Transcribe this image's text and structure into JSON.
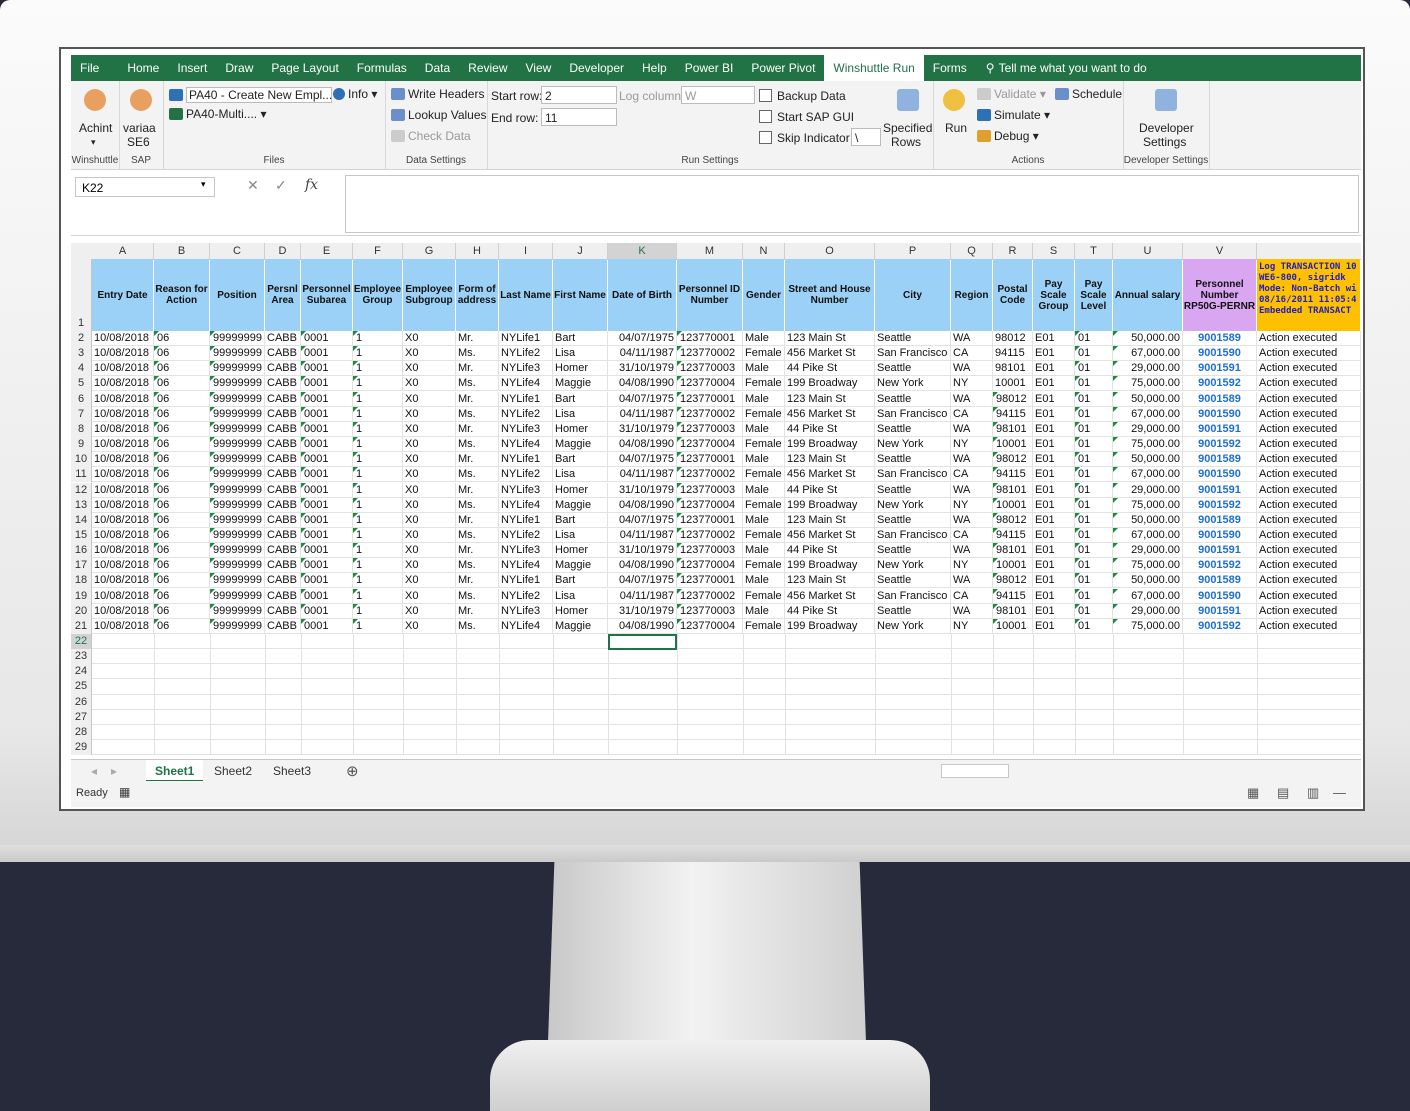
{
  "ribbon": {
    "tabs": [
      "File",
      "Home",
      "Insert",
      "Draw",
      "Page Layout",
      "Formulas",
      "Data",
      "Review",
      "View",
      "Developer",
      "Help",
      "Power BI",
      "Power Pivot",
      "Winshuttle Run",
      "Forms"
    ],
    "active_tab": "Winshuttle Run",
    "tell_me": "Tell me what you want to do",
    "winshuttle": {
      "achint": "Achint",
      "label": "Winshuttle"
    },
    "sap": {
      "variaa": "variaa",
      "se6": "SE6",
      "label": "SAP"
    },
    "files": {
      "pa40": "PA40 - Create New Empl...",
      "pa40multi": "PA40-Multi....",
      "info": "Info",
      "label": "Files"
    },
    "data_settings": {
      "write_headers": "Write Headers",
      "lookup_values": "Lookup Values",
      "check_data": "Check Data",
      "label": "Data Settings"
    },
    "run_settings": {
      "start_row_label": "Start row:",
      "start_row": "2",
      "end_row_label": "End row:",
      "end_row": "11",
      "log_column_label": "Log column:",
      "log_column": "W",
      "backup_data": "Backup Data",
      "start_sap_gui": "Start SAP GUI",
      "skip_indicator": "Skip Indicator",
      "skip_value": "\\",
      "specified": "Specified",
      "rows": "Rows",
      "label": "Run Settings"
    },
    "actions": {
      "run": "Run",
      "validate": "Validate",
      "schedule": "Schedule",
      "simulate": "Simulate",
      "debug": "Debug",
      "label": "Actions"
    },
    "developer": {
      "settings": "Developer",
      "settings2": "Settings",
      "label": "Developer Settings"
    }
  },
  "formula_bar": {
    "name_box": "K22",
    "fx": "fx"
  },
  "columns": [
    "A",
    "B",
    "C",
    "D",
    "E",
    "F",
    "G",
    "H",
    "I",
    "J",
    "K",
    "M",
    "N",
    "O",
    "P",
    "Q",
    "R",
    "S",
    "T",
    "U",
    "V"
  ],
  "headers": [
    "Entry Date",
    "Reason for Action",
    "Position",
    "Persnl Area",
    "Personnel Subarea",
    "Employee Group",
    "Employee Subgroup",
    "Form of address",
    "Last Name",
    "First Name",
    "Date of Birth",
    "Personnel ID Number",
    "Gender",
    "Street and House Number",
    "City",
    "Region",
    "Postal Code",
    "Pay Scale Group",
    "Pay Scale Level",
    "Annual salary",
    "Personnel Number RP50G-PERNR",
    "Log TRANSACTION 10 WE6-800, sigridk Mode: Non-Batch wi 08/16/2011 11:05:4 Embedded TRANSACT"
  ],
  "people": [
    [
      "NYLife1",
      "Bart",
      "04/07/1975",
      "123770001",
      "Male",
      "123 Main St",
      "Seattle",
      "WA",
      "98012",
      "50,000.00",
      "9001589",
      "Mr."
    ],
    [
      "NYLife2",
      "Lisa",
      "04/11/1987",
      "123770002",
      "Female",
      "456 Market St",
      "San Francisco",
      "CA",
      "94115",
      "67,000.00",
      "9001590",
      "Ms."
    ],
    [
      "NYLife3",
      "Homer",
      "31/10/1979",
      "123770003",
      "Male",
      "44 Pike St",
      "Seattle",
      "WA",
      "98101",
      "29,000.00",
      "9001591",
      "Mr."
    ],
    [
      "NYLife4",
      "Maggie",
      "04/08/1990",
      "123770004",
      "Female",
      "199 Broadway",
      "New York",
      "NY",
      "10001",
      "75,000.00",
      "9001592",
      "Ms."
    ]
  ],
  "common": {
    "entry_date": "10/08/2018",
    "reason": "06",
    "position": "99999999",
    "area": "CABB",
    "subarea": "0001",
    "group": "1",
    "subgroup": "X0",
    "psgroup": "E01",
    "pslevel": "01",
    "log": "Action executed"
  },
  "row_numbers": [
    "1",
    "2",
    "3",
    "4",
    "5",
    "6",
    "7",
    "8",
    "9",
    "10",
    "11",
    "12",
    "13",
    "14",
    "15",
    "16",
    "17",
    "18",
    "19",
    "20",
    "21",
    "22",
    "23",
    "24",
    "25",
    "26",
    "27",
    "28",
    "29"
  ],
  "sheets": [
    "Sheet1",
    "Sheet2",
    "Sheet3"
  ],
  "status": "Ready"
}
